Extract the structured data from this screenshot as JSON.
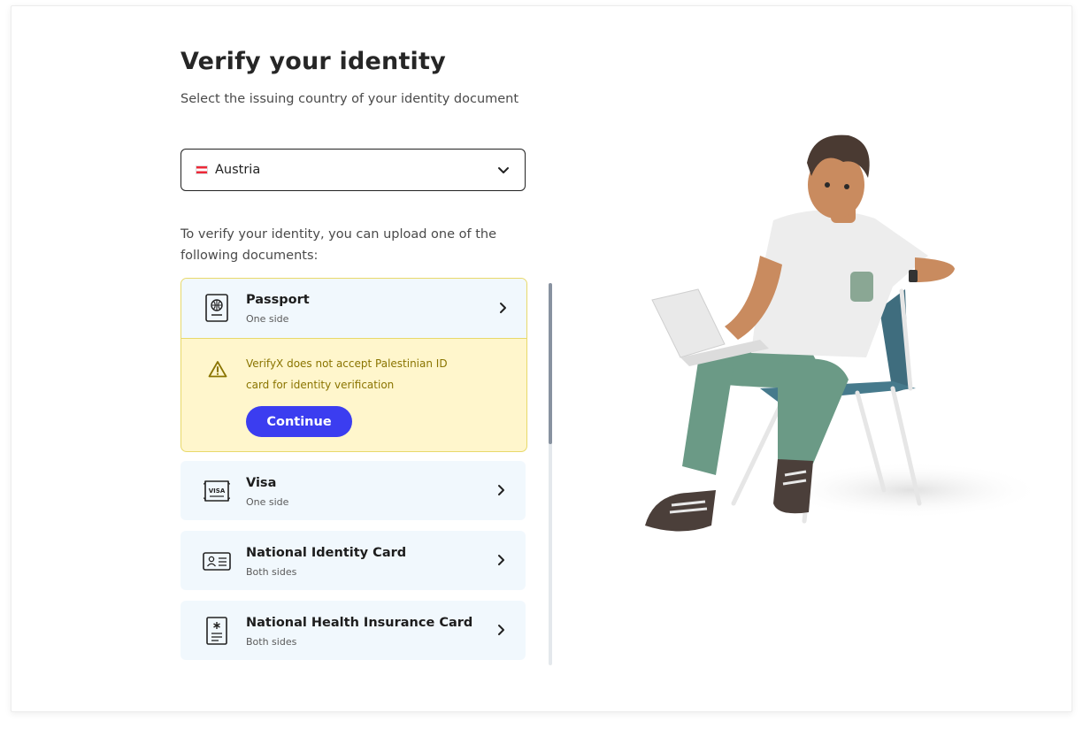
{
  "page": {
    "title": "Verify your identity",
    "subtitle": "Select the issuing country of your identity document"
  },
  "country_select": {
    "value": "Austria",
    "flag_icon": "austria-flag-icon",
    "dropdown_icon": "chevron-down-icon"
  },
  "intro_text": "To verify your identity, you can upload one of the following documents:",
  "documents": [
    {
      "name": "Passport",
      "sides": "One side",
      "icon": "passport-icon",
      "expanded": true
    },
    {
      "name": "Visa",
      "sides": "One side",
      "icon": "visa-icon"
    },
    {
      "name": "National Identity Card",
      "sides": "Both sides",
      "icon": "id-card-icon"
    },
    {
      "name": "National Health Insurance Card",
      "sides": "Both sides",
      "icon": "health-card-icon"
    }
  ],
  "warning": {
    "icon": "warning-icon",
    "text": "VerifyX does not accept Palestinian ID card for identity verification",
    "button_label": "Continue"
  },
  "colors": {
    "accent": "#3b3df0",
    "warning_bg": "#fff6cc",
    "warning_border": "#e8d96a",
    "warning_text": "#8a7400",
    "doc_bg": "#f1f8fd"
  }
}
